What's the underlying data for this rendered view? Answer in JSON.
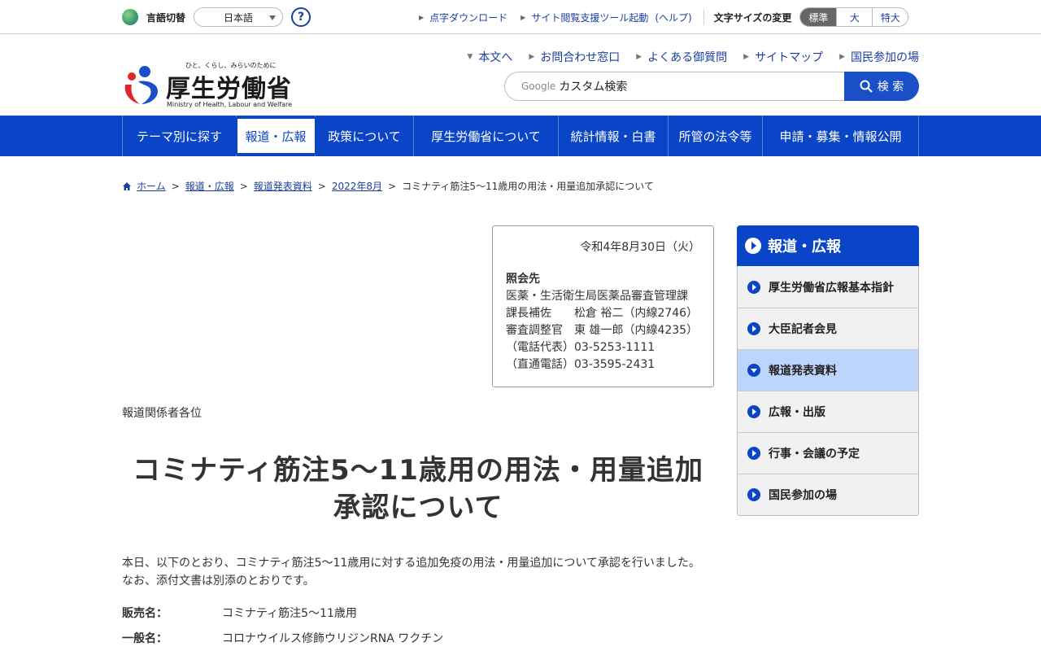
{
  "util": {
    "lang_label": "言語切替",
    "lang_value": "日本語",
    "help_icon": "?",
    "links": [
      "点字ダウンロード",
      "サイト閲覧支援ツール起動"
    ],
    "help_text": "(ヘルプ)",
    "fontsize_label": "文字サイズの変更",
    "fontsize_options": [
      "標準",
      "大",
      "特大"
    ]
  },
  "header": {
    "logo_tagline": "ひと、くらし、みらいのために",
    "logo_name": "厚生労働省",
    "logo_en": "Ministry of Health, Labour and Welfare",
    "links": [
      "本文へ",
      "お問合わせ窓口",
      "よくある御質問",
      "サイトマップ",
      "国民参加の場"
    ],
    "search_google": "Google",
    "search_placeholder": "カスタム検索",
    "search_button": "検 索"
  },
  "gnav": [
    "テーマ別に探す",
    "報道・広報",
    "政策について",
    "厚生労働省について",
    "統計情報・白書",
    "所管の法令等",
    "申請・募集・情報公開"
  ],
  "breadcrumb": [
    "ホーム",
    "報道・広報",
    "報道発表資料",
    "2022年8月",
    "コミナティ筋注5～11歳用の用法・用量追加承認について"
  ],
  "contact": {
    "date": "令和4年8月30日（火）",
    "heading": "照会先",
    "lines": [
      "医薬・生活衛生局医薬品審査管理課",
      "課長補佐　　松倉 裕二（内線2746）",
      "審査調整官　東 雄一郎（内線4235）",
      "（電話代表）03-5253-1111",
      "（直通電話）03-3595-2431"
    ]
  },
  "audience": "報道関係者各位",
  "title_line1": "コミナティ筋注5～11歳用の用法・用量追加",
  "title_line2": "承認について",
  "body": {
    "line1": "本日、以下のとおり、コミナティ筋注5～11歳用に対する追加免疫の用法・用量追加について承認を行いました。",
    "line2": "なお、添付文書は別添のとおりです。"
  },
  "info": [
    {
      "key": "販売名：",
      "value": "コミナティ筋注5～11歳用"
    },
    {
      "key": "一般名：",
      "value": "コロナウイルス修飾ウリジンRNA ワクチン"
    }
  ],
  "side": {
    "heading": "報道・広報",
    "items": [
      "厚生労働省広報基本指針",
      "大臣記者会見",
      "報道発表資料",
      "広報・出版",
      "行事・会議の予定",
      "国民参加の場"
    ]
  }
}
